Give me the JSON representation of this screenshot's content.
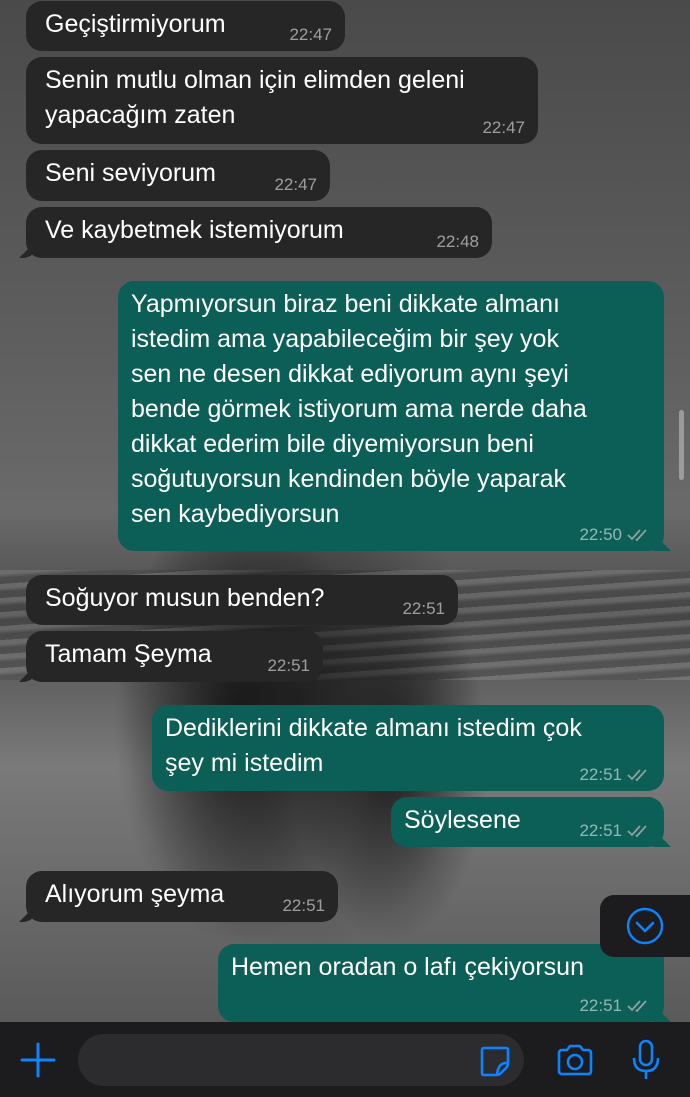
{
  "messages": [
    {
      "text": "Geçiştirmiyorum",
      "time": "22:47",
      "dir": "in"
    },
    {
      "text": "Senin mutlu olman için elimden geleni\nyapacağım zaten",
      "time": "22:47",
      "dir": "in"
    },
    {
      "text": "Seni seviyorum",
      "time": "22:47",
      "dir": "in"
    },
    {
      "text": "Ve kaybetmek istemiyorum",
      "time": "22:48",
      "dir": "in"
    },
    {
      "text": "Yapmıyorsun biraz beni dikkate almanı\nistedim ama yapabileceğim bir şey yok\nsen ne desen dikkat ediyorum aynı şeyi\nbende görmek istiyorum ama nerde daha\ndikkat ederim bile diyemiyorsun beni\nsoğutuyorsun kendinden böyle yaparak\nsen kaybediyorsun",
      "time": "22:50",
      "dir": "out"
    },
    {
      "text": "Soğuyor musun benden?",
      "time": "22:51",
      "dir": "in"
    },
    {
      "text": "Tamam Şeyma",
      "time": "22:51",
      "dir": "in"
    },
    {
      "text": "Dediklerini dikkate almanı istedim çok\nşey mi istedim",
      "time": "22:51",
      "dir": "out"
    },
    {
      "text": "Söylesene",
      "time": "22:51",
      "dir": "out"
    },
    {
      "text": "Alıyorum şeyma",
      "time": "22:51",
      "dir": "in"
    },
    {
      "text": "Hemen oradan o lafı çekiyorsun",
      "time": "22:51",
      "dir": "out"
    }
  ],
  "composer": {
    "placeholder": "",
    "icons": [
      "plus-icon",
      "sticker-icon",
      "camera-icon",
      "microphone-icon"
    ]
  },
  "scroll_button_icon": "chevron-down-circle-icon",
  "colors": {
    "incoming_bubble": "#262626",
    "outgoing_bubble": "#0c5f57",
    "accent": "#0a84ff",
    "read_ticks": "#8fa39f"
  }
}
